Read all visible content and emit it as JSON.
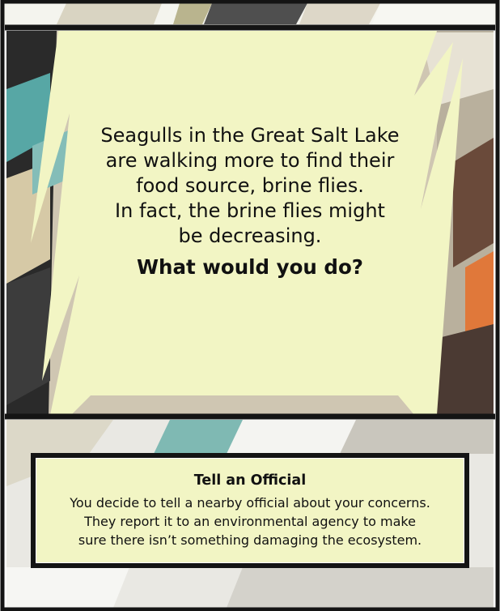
{
  "story": {
    "lines": [
      "Seagulls in the Great Salt Lake",
      "are walking more to find their",
      "food source, brine flies.",
      "In fact, the brine flies might",
      "be decreasing."
    ],
    "question": "What would you do?"
  },
  "choice": {
    "title": "Tell an Official",
    "description_lines": [
      "You decide to tell a nearby official about your concerns.",
      "They report it to an environmental agency to make",
      "sure there isn’t something damaging the ecosystem."
    ]
  },
  "colors": {
    "panel": "#f2f5c4",
    "frame": "#141414",
    "text": "#111111"
  }
}
